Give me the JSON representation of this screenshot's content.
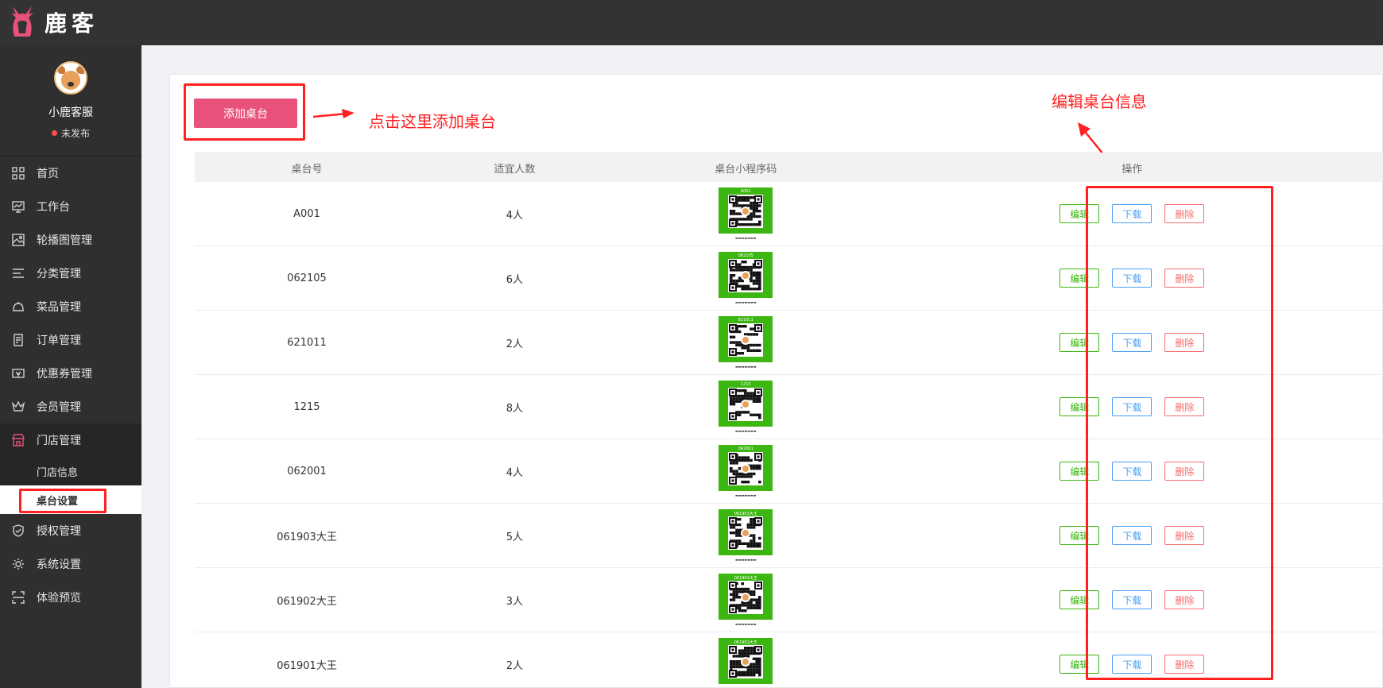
{
  "brand": {
    "name": "鹿客"
  },
  "profile": {
    "name": "小鹿客服",
    "status": "未发布"
  },
  "nav": [
    {
      "label": "首页",
      "icon": "grid-icon"
    },
    {
      "label": "工作台",
      "icon": "monitor-icon"
    },
    {
      "label": "轮播图管理",
      "icon": "image-icon"
    },
    {
      "label": "分类管理",
      "icon": "list-icon"
    },
    {
      "label": "菜品管理",
      "icon": "dish-icon"
    },
    {
      "label": "订单管理",
      "icon": "order-icon"
    },
    {
      "label": "优惠券管理",
      "icon": "coupon-icon"
    },
    {
      "label": "会员管理",
      "icon": "crown-icon"
    },
    {
      "label": "门店管理",
      "icon": "store-icon"
    },
    {
      "label": "授权管理",
      "icon": "shield-icon"
    },
    {
      "label": "系统设置",
      "icon": "gear-icon"
    },
    {
      "label": "体验预览",
      "icon": "scan-icon"
    }
  ],
  "subnav": [
    {
      "label": "门店信息"
    },
    {
      "label": "桌台设置"
    }
  ],
  "toolbar": {
    "add_label": "添加桌台"
  },
  "annotations": {
    "add_hint": "点击这里添加桌台",
    "edit_hint": "编辑桌台信息"
  },
  "table": {
    "headers": [
      "桌台号",
      "适宜人数",
      "桌台小程序码",
      "操作"
    ],
    "rows": [
      {
        "table_no": "A001",
        "seats": "4人"
      },
      {
        "table_no": "062105",
        "seats": "6人"
      },
      {
        "table_no": "621011",
        "seats": "2人"
      },
      {
        "table_no": "1215",
        "seats": "8人"
      },
      {
        "table_no": "062001",
        "seats": "4人"
      },
      {
        "table_no": "061903大王",
        "seats": "5人"
      },
      {
        "table_no": "061902大王",
        "seats": "3人"
      },
      {
        "table_no": "061901大王",
        "seats": "2人"
      }
    ],
    "actions": {
      "edit": "编辑",
      "download": "下载",
      "delete": "删除"
    }
  },
  "colors": {
    "brand": "#e8527a",
    "qr_green": "#3cb611",
    "annotation_red": "#ff2020"
  }
}
